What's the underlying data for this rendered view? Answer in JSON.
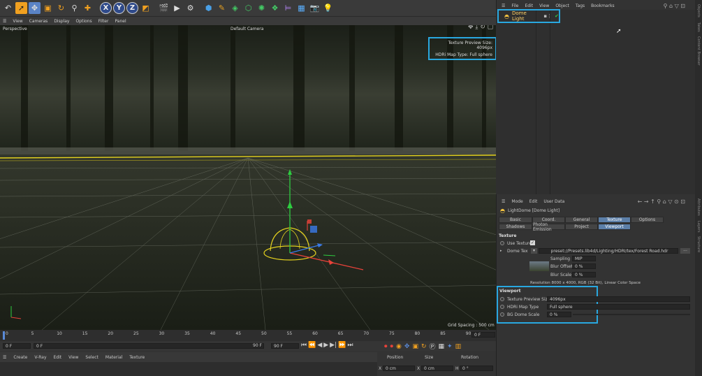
{
  "toolbar": {
    "axes": [
      "X",
      "Y",
      "Z"
    ]
  },
  "viewport_menu": {
    "items": [
      "View",
      "Cameras",
      "Display",
      "Options",
      "Filter",
      "Panel"
    ]
  },
  "viewport": {
    "view_name": "Perspective",
    "camera_name": "Default Camera",
    "info_line1": "Texture Preview Size: 4096px",
    "info_line2": "HDRi Map Type: Full sphere",
    "grid_spacing": "Grid Spacing : 500 cm"
  },
  "timeline": {
    "ticks": [
      "0",
      "5",
      "10",
      "15",
      "20",
      "25",
      "30",
      "35",
      "40",
      "45",
      "50",
      "55",
      "60",
      "65",
      "70",
      "75",
      "80",
      "85",
      "90"
    ],
    "current_frame_left": "0 F",
    "start_frame": "0 F",
    "end_frame": "90 F",
    "end_frame2": "90 F",
    "current_frame_right": "0 F"
  },
  "material_menu": {
    "items": [
      "Create",
      "V-Ray",
      "Edit",
      "View",
      "Select",
      "Material",
      "Texture"
    ]
  },
  "coordinates": {
    "headers": [
      "Position",
      "Size",
      "Rotation"
    ],
    "row_x": {
      "pos_label": "X",
      "pos": "0 cm",
      "size_label": "X",
      "size": "0 cm",
      "rot_label": "H",
      "rot": "0 °"
    }
  },
  "object_manager": {
    "menu": [
      "File",
      "Edit",
      "View",
      "Object",
      "Tags",
      "Bookmarks"
    ],
    "object_name": "Dome Light"
  },
  "attribute_manager": {
    "menu": [
      "Mode",
      "Edit",
      "User Data"
    ],
    "title": "LightDome [Dome Light]",
    "tabs_row1": [
      "Basic",
      "Coord.",
      "General",
      "Texture",
      "Options"
    ],
    "tabs_row2": [
      "Shadows",
      "Photon Emission",
      "Project",
      "Viewport"
    ],
    "active_tabs": [
      "Texture",
      "Viewport"
    ],
    "texture_section": "Texture",
    "use_texture_label": "Use Texture",
    "dome_tex_label": "Dome Tex",
    "dome_tex_path": "preset://Presets.lib4d/Lighting/HDRI/tex/Forest Road.hdr",
    "sampling_label": "Sampling",
    "sampling_value": "MIP",
    "blur_offset_label": "Blur Offset",
    "blur_offset_value": "0 %",
    "blur_scale_label": "Blur Scale",
    "blur_scale_value": "0 %",
    "resolution_text": "Resolution 8000 x 4000, RGB (32 Bit), Linear Color Space",
    "viewport_section": "Viewport",
    "preview_size_label": "Texture Preview Size",
    "preview_size_value": "4096px",
    "hdri_map_label": "HDRi Map Type",
    "hdri_map_value": "Full sphere",
    "bg_dome_label": "BG Dome Scale",
    "bg_dome_value": "0 %"
  },
  "side_tabs": [
    "Objects",
    "Takes",
    "Content Browser",
    "Attributes",
    "Layers",
    "Structure"
  ],
  "colors": {
    "highlight": "#29a8e0",
    "active_tab": "#5c7fa8",
    "axis_y": "#2ecc40",
    "axis_x": "#e8423a",
    "axis_z": "#3a7be8",
    "dome": "#e6d31e"
  }
}
